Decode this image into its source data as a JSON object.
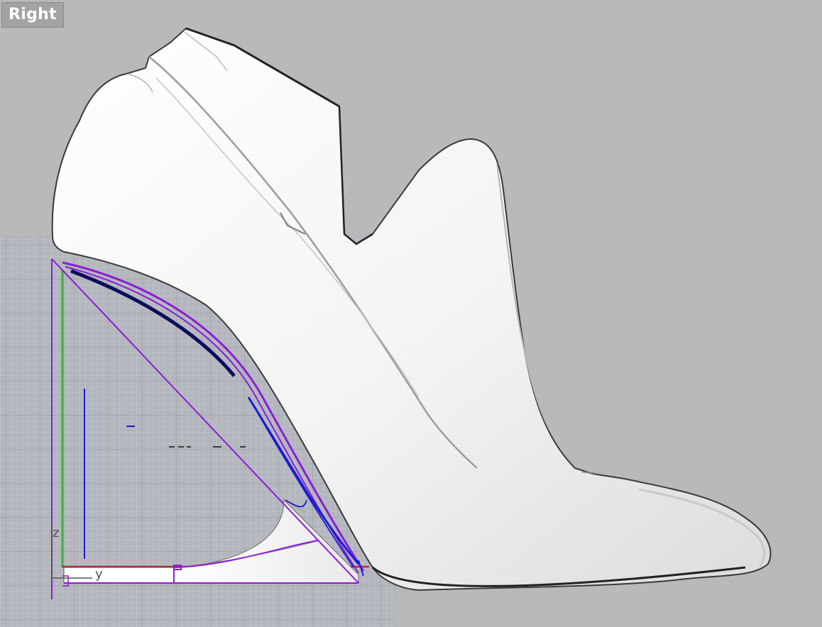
{
  "viewport": {
    "title": "Right"
  },
  "axes": {
    "z_label": "z",
    "y_label": "y"
  },
  "colors": {
    "background": "#b9b9b9",
    "grid_background": "#b4b8be",
    "grid_minor": "#c9ccd1",
    "grid_major": "#9ea3aa",
    "model": "#f4f4f4",
    "curve_purple": "#8a1ed6",
    "curve_blue": "#1b1bd6",
    "axis_green": "#3cae3c",
    "axis_red": "#b42a2a"
  }
}
